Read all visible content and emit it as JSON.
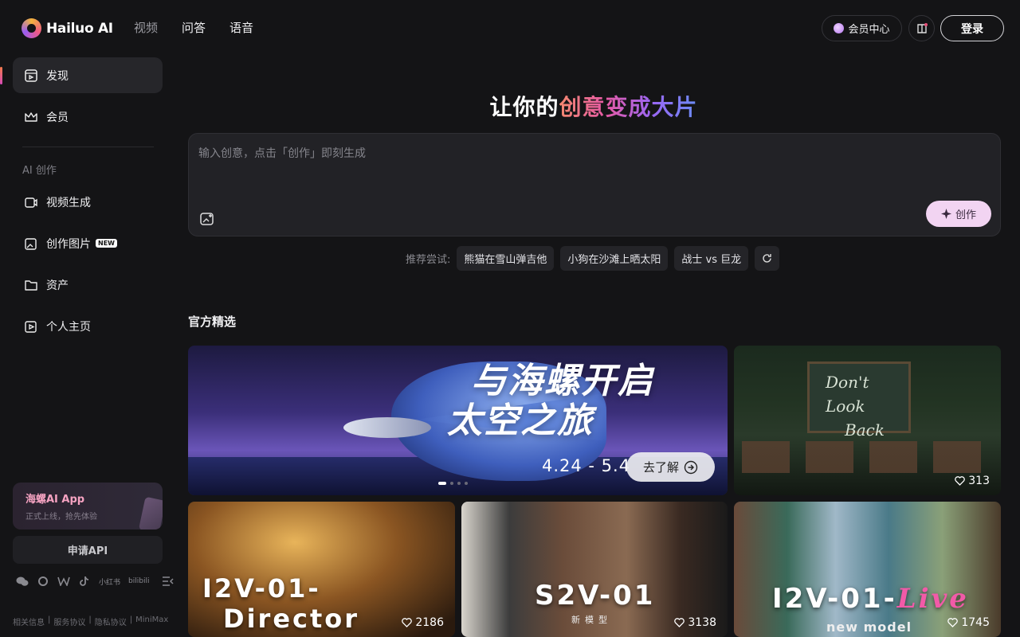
{
  "brand": {
    "name": "Hailuo AI"
  },
  "topnav": {
    "video": "视频",
    "qa": "问答",
    "voice": "语音"
  },
  "header": {
    "vip_center": "会员中心",
    "login": "登录"
  },
  "sidebar": {
    "discover": "发现",
    "membership": "会员",
    "section_ai": "AI 创作",
    "video_gen": "视频生成",
    "image_gen": "创作图片",
    "image_gen_badge": "NEW",
    "assets": "资产",
    "profile": "个人主页",
    "app_title": "海螺AI App",
    "app_sub": "正式上线，抢先体验",
    "api_btn": "申请API",
    "social": [
      "小红书",
      "bilibili"
    ],
    "footer": [
      "相关信息",
      "服务协议",
      "隐私协议",
      "MiniMax"
    ]
  },
  "hero": {
    "title_plain": "让你的",
    "title_grad": "创意变成大片",
    "placeholder": "输入创意，点击「创作」即刻生成",
    "create_btn": "创作"
  },
  "suggestions": {
    "label": "推荐尝试:",
    "items": [
      "熊猫在雪山弹吉他",
      "小狗在沙滩上晒太阳",
      "战士 vs 巨龙"
    ]
  },
  "featured": {
    "title": "官方精选",
    "banner": {
      "line1": "与海螺开启",
      "line2": "太空之旅",
      "date": "4.24 - 5.4",
      "button": "去了解"
    },
    "cards": [
      {
        "board_line1": "Don't Look",
        "board_line2": "Back",
        "likes": "313"
      },
      {
        "label_a": "I2V-01-",
        "label_b": "Director",
        "likes": "2186"
      },
      {
        "label": "S2V-01",
        "sub": "新模型",
        "likes": "3138"
      },
      {
        "label_a": "I2V-01-",
        "label_b": "Live",
        "sub": "new model",
        "likes": "1745"
      }
    ]
  },
  "colors": {
    "background": "#141416",
    "accent_pink": "#f2d4f2",
    "gradient_start": "#f48870",
    "gradient_end": "#6a8cf5"
  }
}
